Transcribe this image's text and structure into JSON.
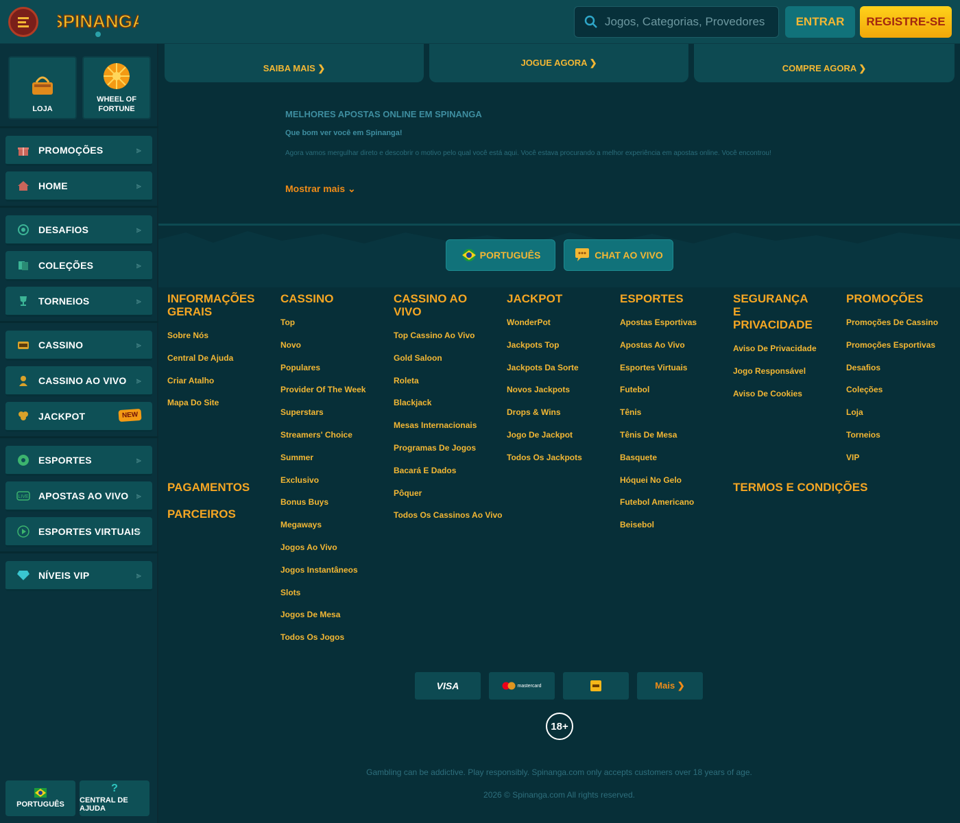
{
  "header": {
    "logo_text": "SPINANGA",
    "search_placeholder": "Jogos, Categorias, Provedores",
    "login_label": "ENTRAR",
    "register_label": "REGISTRE-SE"
  },
  "sidebar": {
    "quick": [
      {
        "label": "LOJA"
      },
      {
        "label": "WHEEL OF FORTUNE"
      }
    ],
    "items": [
      {
        "label": "PROMOÇÕES",
        "icon": "gift-icon"
      },
      {
        "label": "HOME",
        "icon": "house-icon"
      },
      {
        "label": "DESAFIOS",
        "icon": "target-icon"
      },
      {
        "label": "COLEÇÕES",
        "icon": "cards-icon"
      },
      {
        "label": "TORNEIOS",
        "icon": "trophy-icon"
      },
      {
        "label": "CASSINO",
        "icon": "slot-icon"
      },
      {
        "label": "CASSINO AO VIVO",
        "icon": "dealer-icon"
      },
      {
        "label": "JACKPOT",
        "icon": "clover-icon",
        "badge": "NEW"
      },
      {
        "label": "ESPORTES",
        "icon": "ball-icon"
      },
      {
        "label": "APOSTAS AO VIVO",
        "icon": "live-icon"
      },
      {
        "label": "ESPORTES VIRTUAIS",
        "icon": "play-icon"
      },
      {
        "label": "NÍVEIS VIP",
        "icon": "diamond-icon"
      }
    ],
    "bottom": [
      {
        "label": "PORTUGUÊS"
      },
      {
        "label": "CENTRAL DE AJUDA"
      }
    ]
  },
  "promo_cards": [
    {
      "label": "SAIBA MAIS ❯"
    },
    {
      "label": "JOGUE AGORA ❯"
    },
    {
      "label": "COMPRE AGORA ❯"
    }
  ],
  "seo": {
    "title": "MELHORES APOSTAS ONLINE EM SPINANGA",
    "subtitle": "Que bom ver você em Spinanga!",
    "body": "Agora vamos mergulhar direto e descobrir o motivo pelo qual você está aqui. Você estava procurando a melhor experiência em apostas online. Você encontrou!",
    "show_more": "Mostrar mais ⌄"
  },
  "footer_buttons": {
    "language": "PORTUGUÊS",
    "chat": "CHAT AO VIVO"
  },
  "columns": [
    {
      "title": "INFORMAÇÕES GERAIS",
      "links": [
        "Sobre Nós",
        "Central De Ajuda",
        "Criar Atalho",
        "Mapa Do Site"
      ]
    },
    {
      "title": "CASSINO",
      "links": [
        "Top",
        "Novo",
        "Populares",
        "Provider Of The Week",
        "Superstars",
        "Streamers' Choice",
        "Summer",
        "Exclusivo",
        "Bonus Buys",
        "Megaways",
        "Jogos Ao Vivo",
        "Jogos Instantâneos",
        "Slots",
        "Jogos De Mesa",
        "Todos Os Jogos"
      ]
    },
    {
      "title": "CASSINO AO VIVO",
      "links": [
        "Top Cassino Ao Vivo",
        "Gold Saloon",
        "Roleta",
        "Blackjack",
        "Mesas Internacionais",
        "Programas De Jogos",
        "Bacará E Dados",
        "Pôquer",
        "Todos Os Cassinos Ao Vivo"
      ]
    },
    {
      "title": "JACKPOT",
      "links": [
        "WonderPot",
        "Jackpots Top",
        "Jackpots Da Sorte",
        "Novos Jackpots",
        "Drops & Wins",
        "Jogo De Jackpot",
        "Todos Os Jackpots"
      ]
    },
    {
      "title": "ESPORTES",
      "links": [
        "Apostas Esportivas",
        "Apostas Ao Vivo",
        "Esportes Virtuais",
        "Futebol",
        "Tênis",
        "Tênis De Mesa",
        "Basquete",
        "Hóquei No Gelo",
        "Futebol Americano",
        "Beisebol"
      ]
    },
    {
      "title": "SEGURANÇA E PRIVACIDADE",
      "links": [
        "Aviso De Privacidade",
        "Jogo Responsável",
        "Aviso De Cookies"
      ]
    },
    {
      "title": "PROMOÇÕES",
      "links": [
        "Promoções De Cassino",
        "Promoções Esportivas",
        "Desafios",
        "Coleções",
        "Loja",
        "Torneios",
        "VIP"
      ]
    }
  ],
  "extra_headings": {
    "payments": "PAGAMENTOS",
    "partners": "PARCEIROS",
    "terms": "TERMOS E CONDIÇÕES"
  },
  "payments": {
    "visa": "VISA",
    "mastercard": "mastercard",
    "more": "Mais ❯"
  },
  "age": "18+",
  "disclaimer": "Gambling can be addictive. Play responsibly. Spinanga.com only accepts customers over 18 years of age.",
  "copyright": "2026 © Spinanga.com All rights reserved.",
  "colors": {
    "accent": "#f3b734",
    "heading": "#f5a623",
    "bg": "#072f38",
    "panel": "#0e5056"
  }
}
